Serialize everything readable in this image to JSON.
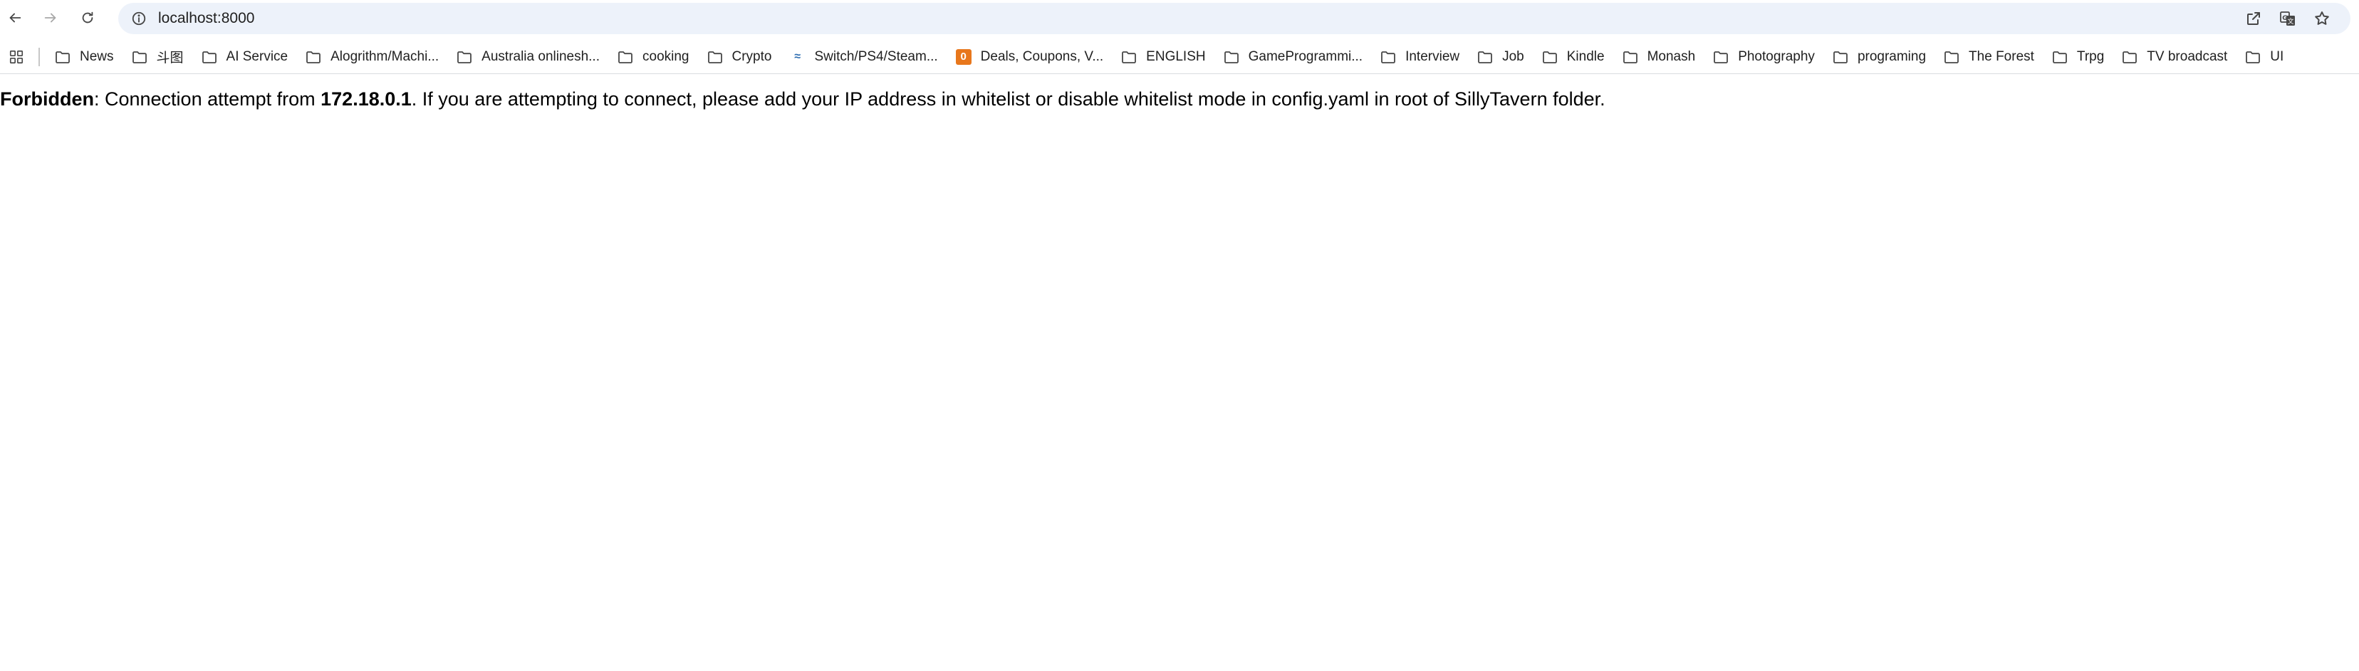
{
  "browser": {
    "url": "localhost:8000",
    "icons": {
      "back": "arrow-left-icon",
      "forward": "arrow-right-icon",
      "reload": "reload-icon",
      "site_info": "info-icon",
      "open_in_app": "open-external-icon",
      "translate": "translate-icon",
      "bookmark": "star-icon",
      "apps": "apps-grid-icon"
    }
  },
  "bookmarks": [
    {
      "label": "News",
      "icon": "folder-icon"
    },
    {
      "label": "斗图",
      "icon": "folder-icon"
    },
    {
      "label": "AI Service",
      "icon": "folder-icon"
    },
    {
      "label": "Alogrithm/Machi...",
      "icon": "folder-icon"
    },
    {
      "label": "Australia onlinesh...",
      "icon": "folder-icon"
    },
    {
      "label": "cooking",
      "icon": "folder-icon"
    },
    {
      "label": "Crypto",
      "icon": "folder-icon"
    },
    {
      "label": "Switch/PS4/Steam...",
      "icon": "site-favicon-icon"
    },
    {
      "label": "Deals, Coupons, V...",
      "icon": "ozbargain-favicon-icon"
    },
    {
      "label": "ENGLISH",
      "icon": "folder-icon"
    },
    {
      "label": "GameProgrammi...",
      "icon": "folder-icon"
    },
    {
      "label": "Interview",
      "icon": "folder-icon"
    },
    {
      "label": "Job",
      "icon": "folder-icon"
    },
    {
      "label": "Kindle",
      "icon": "folder-icon"
    },
    {
      "label": "Monash",
      "icon": "folder-icon"
    },
    {
      "label": "Photography",
      "icon": "folder-icon"
    },
    {
      "label": "programing",
      "icon": "folder-icon"
    },
    {
      "label": "The Forest",
      "icon": "folder-icon"
    },
    {
      "label": "Trpg",
      "icon": "folder-icon"
    },
    {
      "label": "TV broadcast",
      "icon": "folder-icon"
    },
    {
      "label": "UI",
      "icon": "folder-icon"
    }
  ],
  "page": {
    "forbidden_label": "Forbidden",
    "text_part1": ": Connection attempt from ",
    "ip_address": "172.18.0.1",
    "text_part2": ". If you are attempting to connect, please add your IP address in whitelist or disable whitelist mode in config.yaml in root of SillyTavern folder."
  },
  "colors": {
    "omnibox_bg": "#edf2fa",
    "icon": "#474747",
    "deals_favicon": "#e8771c"
  }
}
